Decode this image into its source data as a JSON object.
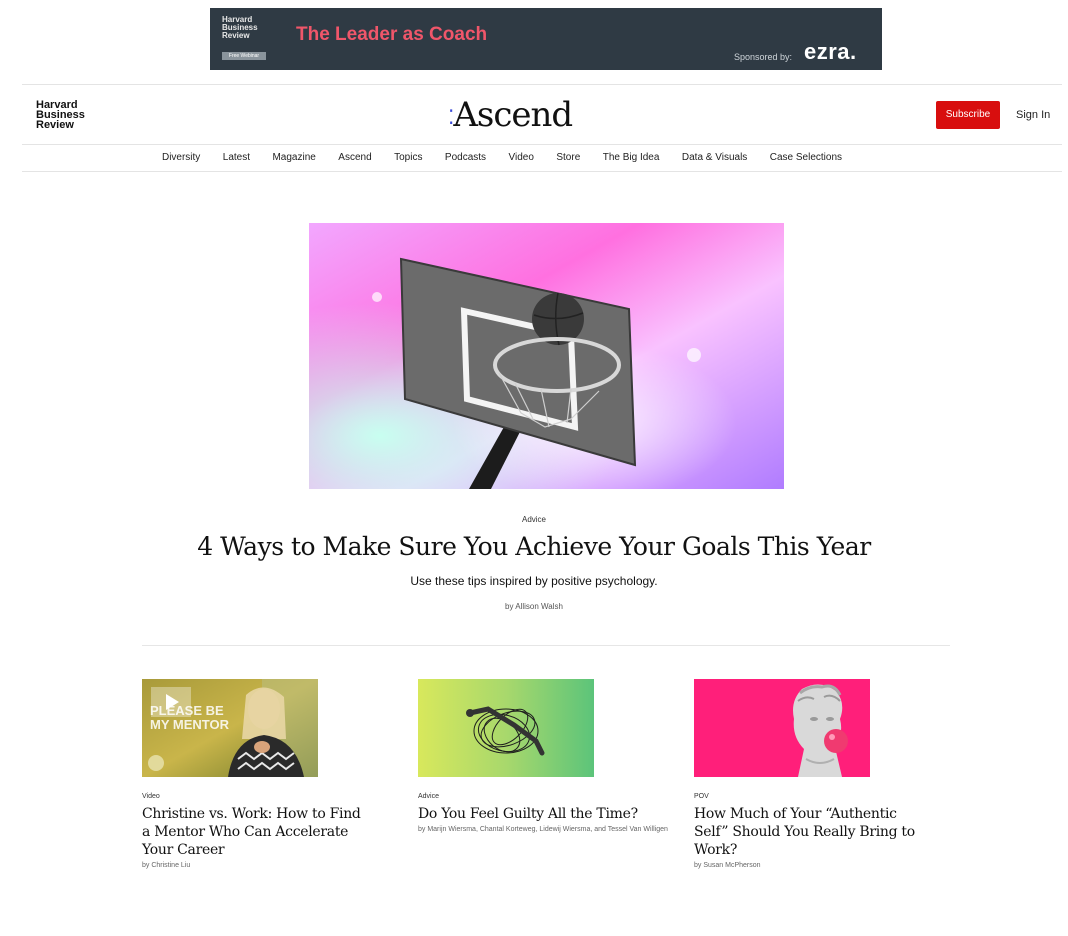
{
  "ad": {
    "logo_lines": [
      "Harvard",
      "Business",
      "Review"
    ],
    "tag": "Free Webinar",
    "title": "The Leader as Coach",
    "sponsored_label": "Sponsored by:",
    "sponsor_brand": "ezra."
  },
  "header": {
    "logo_lines": [
      "Harvard",
      "Business",
      "Review"
    ],
    "wordmark": "Ascend",
    "subscribe_label": "Subscribe",
    "signin_label": "Sign In"
  },
  "nav": {
    "items": [
      "Diversity",
      "Latest",
      "Magazine",
      "Ascend",
      "Topics",
      "Podcasts",
      "Video",
      "Store",
      "The Big Idea",
      "Data & Visuals",
      "Case Selections"
    ]
  },
  "hero": {
    "image_icon": "basketball-hoop-image",
    "kicker": "Advice",
    "title": "4 Ways to Make Sure You Achieve Your Goals This Year",
    "dek": "Use these tips inspired by positive psychology.",
    "byline": "by Allison Walsh"
  },
  "cards": [
    {
      "image_text": "PLEASE BE MY MENTOR",
      "kicker": "Video",
      "title": "Christine vs. Work: How to Find a Mentor Who Can Accelerate Your Career",
      "byline": "by Christine Liu"
    },
    {
      "kicker": "Advice",
      "title": "Do You Feel Guilty All the Time?",
      "byline": "by Marijn Wiersma, Chantal Korteweg, Lidewij Wiersma, and Tessel Van Willigen"
    },
    {
      "kicker": "POV",
      "title": "How Much of Your “Authentic Self” Should You Really Bring to Work?",
      "byline": "by Susan McPherson"
    }
  ],
  "colors": {
    "ad_background": "#2f3a44",
    "ad_title": "#f0566a",
    "subscribe": "#d80e0e",
    "accent_pink": "#ff1f7a"
  }
}
